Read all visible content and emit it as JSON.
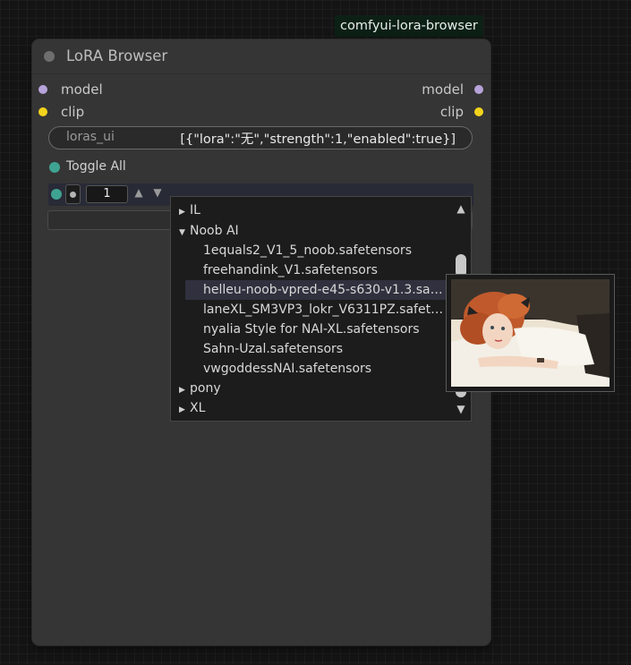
{
  "node_tag": "comfyui-lora-browser",
  "node": {
    "title": "LoRA Browser",
    "inputs": [
      {
        "label": "model",
        "color": "#b6a3d9"
      },
      {
        "label": "clip",
        "color": "#f2d31c"
      }
    ],
    "outputs": [
      {
        "label": "model",
        "color": "#b6a3d9"
      },
      {
        "label": "clip",
        "color": "#f2d31c"
      }
    ],
    "widget": {
      "name": "loras_ui",
      "value": "[{\"lora\":\"无\",\"strength\":1,\"enabled\":true}]"
    },
    "toggle_all_label": "Toggle All",
    "lora_row": {
      "strength": "1",
      "up_arrow": "▲",
      "down_arrow": "▼"
    }
  },
  "dropdown": {
    "folders": [
      {
        "label": "IL",
        "expanded": false
      },
      {
        "label": "Noob AI",
        "expanded": true
      },
      {
        "label": "pony",
        "expanded": false
      },
      {
        "label": "XL",
        "expanded": false
      }
    ],
    "files": [
      "1equals2_V1_5_noob.safetensors",
      "freehandink_V1.safetensors",
      "helleu-noob-vpred-e45-s630-v1.3.safe...",
      "laneXL_SM3VP3_lokr_V6311PZ.safeten...",
      "nyalia Style for NAI-XL.safetensors",
      "Sahn-Uzal.safetensors",
      "vwgoddessNAI.safetensors"
    ],
    "highlighted_file": "helleu-noob-vpred-e45-s630-v1.3.safe..."
  },
  "icons": {
    "collapsed": "▶",
    "expanded": "▼",
    "scroll_up": "▲",
    "scroll_down": "▼"
  }
}
